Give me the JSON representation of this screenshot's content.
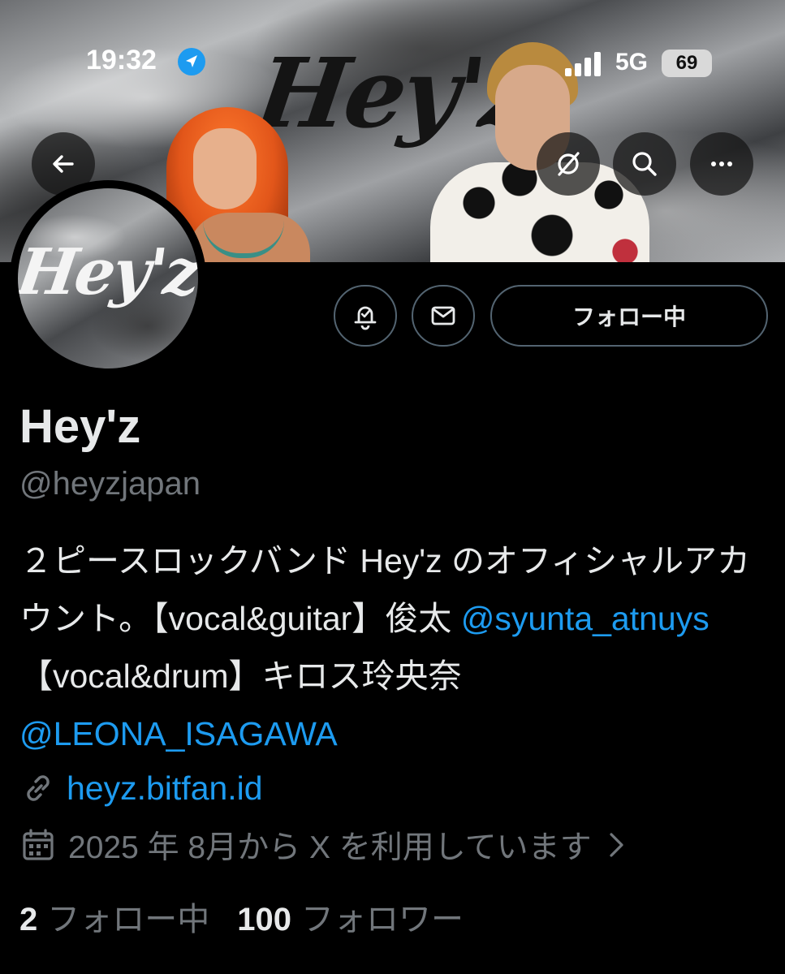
{
  "status_bar": {
    "time": "19:32",
    "network": "5G",
    "battery": "69"
  },
  "banner": {
    "logo_text": "Hey'z"
  },
  "avatar": {
    "logo_text": "Hey'z"
  },
  "actions": {
    "follow_label": "フォロー中"
  },
  "profile": {
    "name": "Hey'z",
    "handle": "@heyzjapan",
    "bio": {
      "part1": "２ピースロックバンド Hey'z のオフィシャルアカウント。【vocal&guitar】俊太 ",
      "mention1": "@syunta_atnuys",
      "part2": "【vocal&drum】キロス玲央奈 ",
      "mention2": "@LEONA_ISAGAWA"
    },
    "link": "heyz.bitfan.id",
    "joined": "2025 年 8月から X を利用しています"
  },
  "stats": {
    "following_count": "2",
    "following_label": "フォロー中",
    "followers_count": "100",
    "followers_label": "フォロワー"
  },
  "icons": {
    "back": "back-arrow-icon",
    "grok": "grok-icon",
    "search": "search-icon",
    "more": "more-icon",
    "notify": "notification-bell-icon",
    "message": "envelope-icon",
    "link": "link-icon",
    "calendar": "calendar-icon",
    "chevron": "chevron-right-icon"
  },
  "colors": {
    "background": "#000000",
    "accent": "#1d9bf0",
    "secondary_text": "#71767b",
    "button_border": "#536471"
  }
}
